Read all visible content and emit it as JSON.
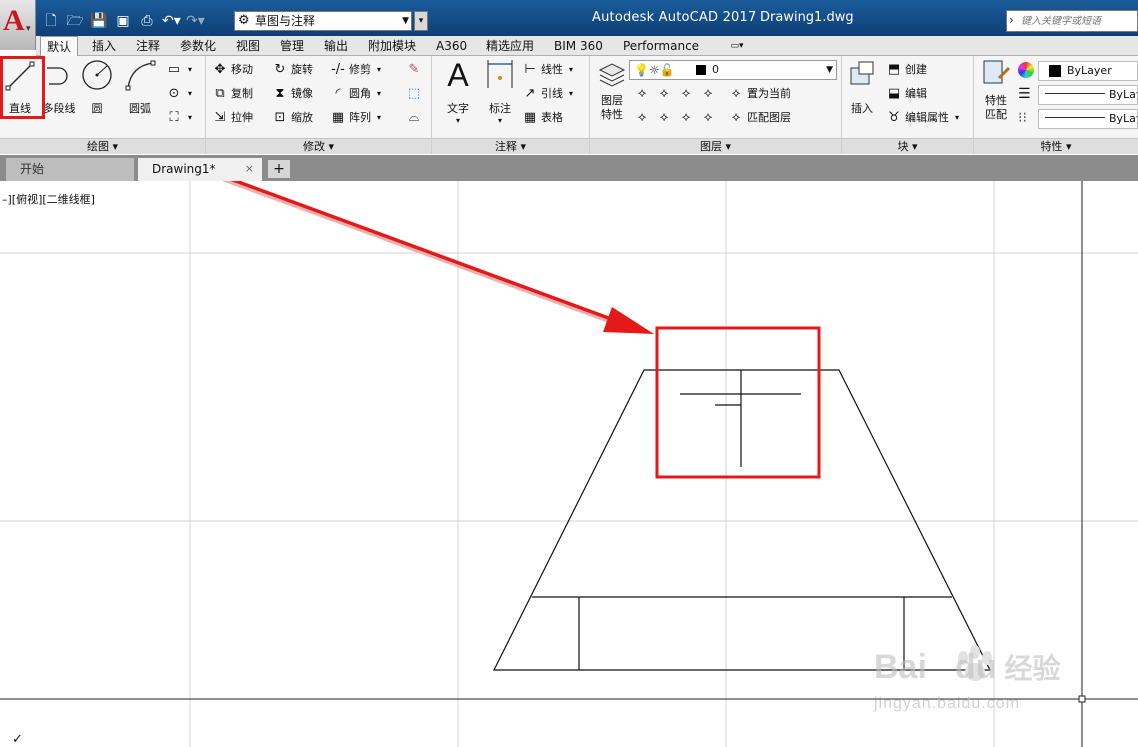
{
  "titlebar": {
    "app_title": "Autodesk AutoCAD 2017",
    "doc_title": "Drawing1.dwg",
    "workspace": "草图与注释",
    "search_placeholder": "键入关键字或短语"
  },
  "ribbon_tabs": [
    "默认",
    "插入",
    "注释",
    "参数化",
    "视图",
    "管理",
    "输出",
    "附加模块",
    "A360",
    "精选应用",
    "BIM 360",
    "Performance"
  ],
  "panels": {
    "draw": {
      "title": "绘图",
      "line": "直线",
      "polyline": "多段线",
      "circle": "圆",
      "arc": "圆弧"
    },
    "modify": {
      "title": "修改",
      "move": "移动",
      "rotate": "旋转",
      "trim": "修剪",
      "copy": "复制",
      "mirror": "镜像",
      "fillet": "圆角",
      "stretch": "拉伸",
      "scale": "缩放",
      "array": "阵列"
    },
    "annotation": {
      "title": "注释",
      "text": "文字",
      "dimension": "标注",
      "linear": "线性",
      "leader": "引线",
      "table": "表格"
    },
    "layers": {
      "title": "图层",
      "properties": "图层\n特性",
      "current_layer": "0",
      "set_current": "置为当前",
      "match_layer": "匹配图层"
    },
    "block": {
      "title": "块",
      "insert": "插入",
      "create": "创建",
      "edit": "编辑",
      "edit_attributes": "编辑属性"
    },
    "properties": {
      "title": "特性",
      "match": "特性\n匹配",
      "color": "ByLayer",
      "linetype": "ByLay",
      "lineweight": "ByLay"
    }
  },
  "doc_tabs": {
    "start": "开始",
    "current": "Drawing1*"
  },
  "viewport_label": "–][俯视][二维线框]",
  "watermark": {
    "brand": "Bai",
    "brand2": "du",
    "cn": "经验",
    "url": "jingyan.baidu.com"
  },
  "colors": {
    "highlight": "#e41a1a",
    "titlebar": "#1a5c9c",
    "grid": "#d4d4d4",
    "ribbon_bg": "#f5f5f5"
  }
}
